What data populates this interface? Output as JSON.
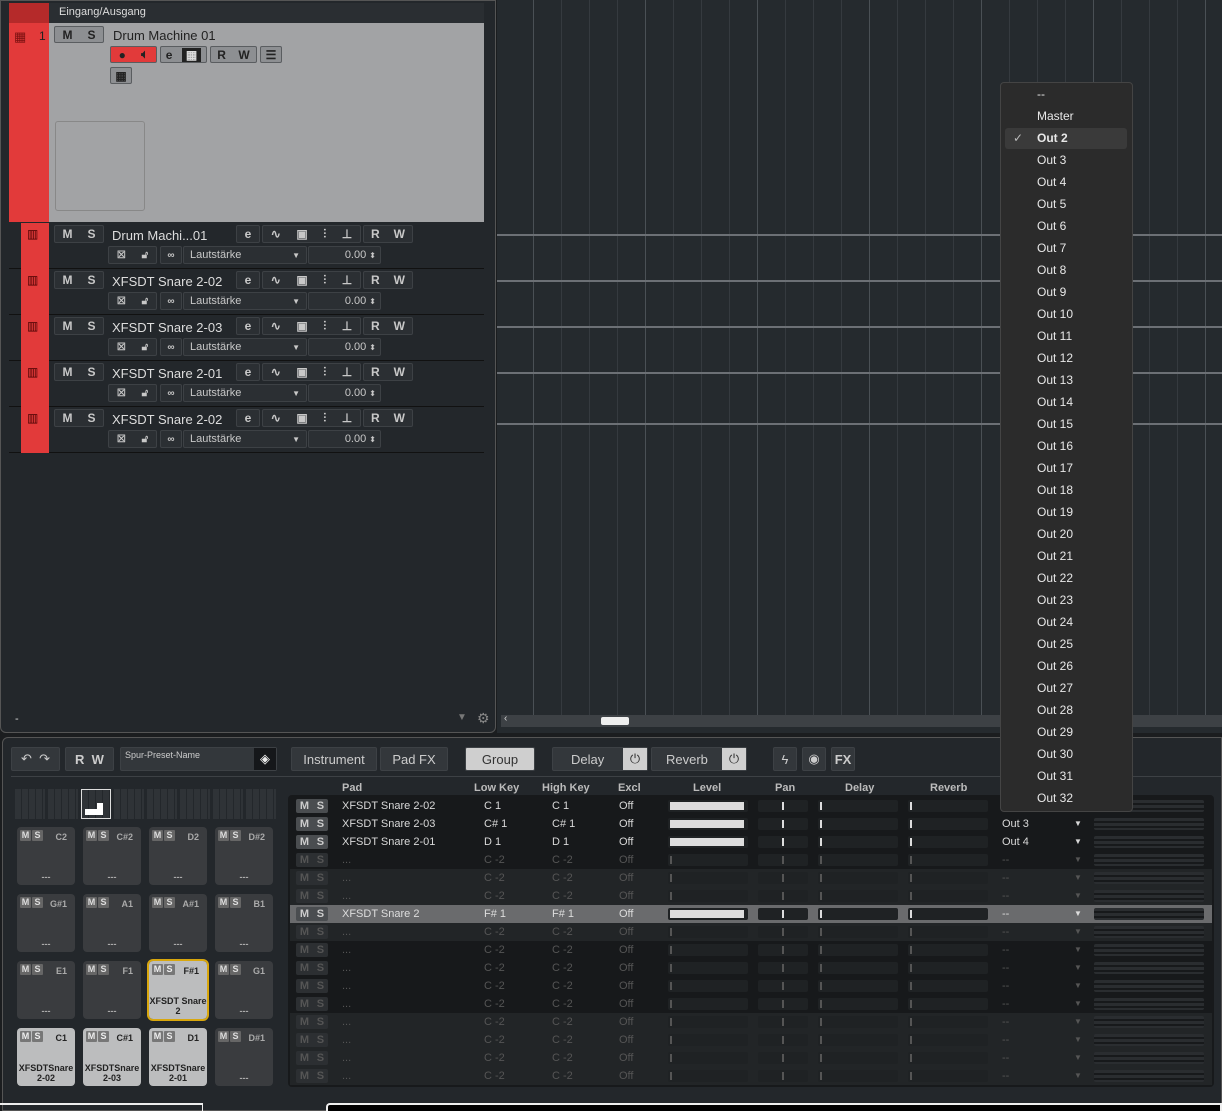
{
  "tracklist": {
    "folder_label": "Eingang/Ausgang",
    "main_track": {
      "number": "1",
      "name": "Drum Machine 01",
      "mute": "M",
      "solo": "S",
      "read": "R",
      "write": "W",
      "color": "#e23a3a"
    },
    "sub_tracks": [
      {
        "name": "Drum Machi...01",
        "param": "Lautstärke",
        "value": "0.00"
      },
      {
        "name": "XFSDT Snare 2-02",
        "param": "Lautstärke",
        "value": "0.00"
      },
      {
        "name": "XFSDT Snare 2-03",
        "param": "Lautstärke",
        "value": "0.00"
      },
      {
        "name": "XFSDT Snare 2-01",
        "param": "Lautstärke",
        "value": "0.00"
      },
      {
        "name": "XFSDT Snare 2-02",
        "param": "Lautstärke",
        "value": "0.00"
      }
    ],
    "footer_dash": "-"
  },
  "output_menu": {
    "items": [
      "--",
      "Master",
      "Out 2",
      "Out 3",
      "Out 4",
      "Out 5",
      "Out 6",
      "Out 7",
      "Out 8",
      "Out 9",
      "Out 10",
      "Out 11",
      "Out 12",
      "Out 13",
      "Out 14",
      "Out 15",
      "Out 16",
      "Out 17",
      "Out 18",
      "Out 19",
      "Out 20",
      "Out 21",
      "Out 22",
      "Out 23",
      "Out 24",
      "Out 25",
      "Out 26",
      "Out 27",
      "Out 28",
      "Out 29",
      "Out 30",
      "Out 31",
      "Out 32"
    ],
    "selected": "Out 2"
  },
  "toolbar": {
    "read": "R",
    "write": "W",
    "preset_placeholder": "Spur-Preset-Name",
    "instrument": "Instrument",
    "pad_fx": "Pad FX",
    "group": "Group",
    "delay": "Delay",
    "reverb": "Reverb",
    "fx": "FX"
  },
  "pads": [
    {
      "key": "C2",
      "label": "---",
      "on": false
    },
    {
      "key": "C#2",
      "label": "---",
      "on": false
    },
    {
      "key": "D2",
      "label": "---",
      "on": false
    },
    {
      "key": "D#2",
      "label": "---",
      "on": false
    },
    {
      "key": "G#1",
      "label": "---",
      "on": false
    },
    {
      "key": "A1",
      "label": "---",
      "on": false
    },
    {
      "key": "A#1",
      "label": "---",
      "on": false
    },
    {
      "key": "B1",
      "label": "---",
      "on": false
    },
    {
      "key": "E1",
      "label": "---",
      "on": false
    },
    {
      "key": "F1",
      "label": "---",
      "on": false
    },
    {
      "key": "F#1",
      "label": "XFSDT Snare 2",
      "on": true,
      "selected": true
    },
    {
      "key": "G1",
      "label": "---",
      "on": false
    },
    {
      "key": "C1",
      "label": "XFSDTSnare 2-02",
      "on": true
    },
    {
      "key": "C#1",
      "label": "XFSDTSnare 2-03",
      "on": true
    },
    {
      "key": "D1",
      "label": "XFSDTSnare 2-01",
      "on": true
    },
    {
      "key": "D#1",
      "label": "---",
      "on": false
    }
  ],
  "pad_table": {
    "columns": [
      "Pad",
      "Low Key",
      "High Key",
      "Excl",
      "Level",
      "Pan",
      "Delay",
      "Reverb"
    ],
    "rows": [
      {
        "pad": "XFSDT Snare 2-02",
        "low": "C 1",
        "high": "C 1",
        "excl": "Off",
        "level": 1,
        "out": "",
        "filled": true
      },
      {
        "pad": "XFSDT Snare 2-03",
        "low": "C# 1",
        "high": "C# 1",
        "excl": "Off",
        "level": 1,
        "out": "Out 3",
        "filled": true
      },
      {
        "pad": "XFSDT Snare 2-01",
        "low": "D 1",
        "high": "D 1",
        "excl": "Off",
        "level": 1,
        "out": "Out 4",
        "filled": true
      },
      {
        "pad": "...",
        "low": "C -2",
        "high": "C -2",
        "excl": "Off",
        "level": 0,
        "out": "--"
      },
      {
        "pad": "...",
        "low": "C -2",
        "high": "C -2",
        "excl": "Off",
        "level": 0,
        "out": "--"
      },
      {
        "pad": "...",
        "low": "C -2",
        "high": "C -2",
        "excl": "Off",
        "level": 0,
        "out": "--"
      },
      {
        "pad": "XFSDT Snare 2",
        "low": "F# 1",
        "high": "F# 1",
        "excl": "Off",
        "level": 1,
        "out": "--",
        "selected": true
      },
      {
        "pad": "...",
        "low": "C -2",
        "high": "C -2",
        "excl": "Off",
        "level": 0,
        "out": "--"
      },
      {
        "pad": "...",
        "low": "C -2",
        "high": "C -2",
        "excl": "Off",
        "level": 0,
        "out": "--"
      },
      {
        "pad": "...",
        "low": "C -2",
        "high": "C -2",
        "excl": "Off",
        "level": 0,
        "out": "--"
      },
      {
        "pad": "...",
        "low": "C -2",
        "high": "C -2",
        "excl": "Off",
        "level": 0,
        "out": "--"
      },
      {
        "pad": "...",
        "low": "C -2",
        "high": "C -2",
        "excl": "Off",
        "level": 0,
        "out": "--"
      },
      {
        "pad": "...",
        "low": "C -2",
        "high": "C -2",
        "excl": "Off",
        "level": 0,
        "out": "--"
      },
      {
        "pad": "...",
        "low": "C -2",
        "high": "C -2",
        "excl": "Off",
        "level": 0,
        "out": "--"
      },
      {
        "pad": "...",
        "low": "C -2",
        "high": "C -2",
        "excl": "Off",
        "level": 0,
        "out": "--"
      },
      {
        "pad": "...",
        "low": "C -2",
        "high": "C -2",
        "excl": "Off",
        "level": 0,
        "out": "--"
      }
    ]
  }
}
